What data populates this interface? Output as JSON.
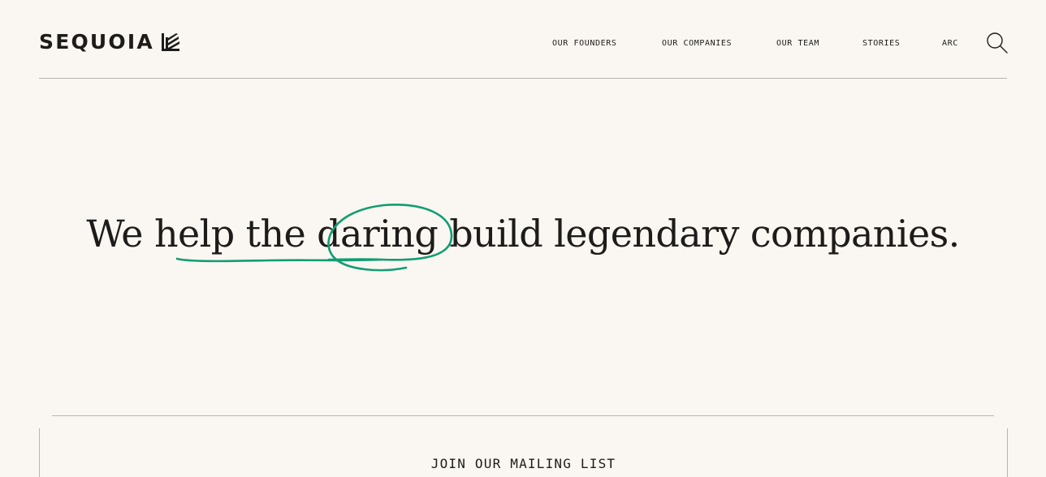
{
  "brand": {
    "name": "SEQUOIA",
    "logo_icon": "sequoia-leaf-mark-icon"
  },
  "nav": {
    "items": [
      {
        "label": "OUR FOUNDERS"
      },
      {
        "label": "OUR COMPANIES"
      },
      {
        "label": "OUR TEAM"
      },
      {
        "label": "STORIES"
      },
      {
        "label": "ARC"
      }
    ],
    "search_icon": "search-icon"
  },
  "hero": {
    "headline": "We help the daring build legendary companies.",
    "accent_color": "#119d73"
  },
  "mailing": {
    "title": "JOIN OUR MAILING LIST"
  }
}
